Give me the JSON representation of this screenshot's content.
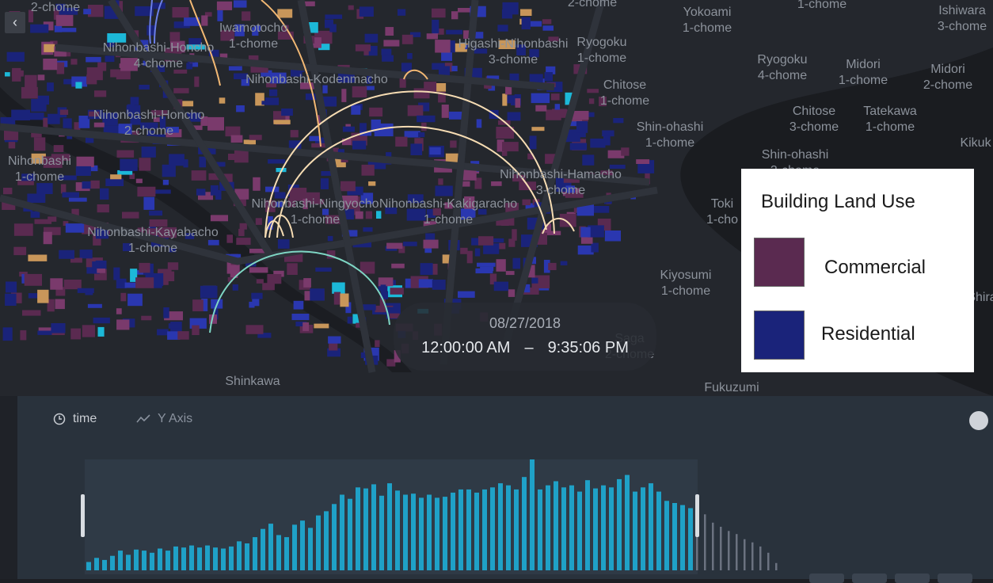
{
  "map": {
    "back_icon": "chevron-left-icon",
    "colors": {
      "commercial": "#5a2a50",
      "commercial_light": "#7a3a6c",
      "residential": "#1a237a",
      "residential_light": "#2a37b0",
      "street": "#2b2e35",
      "water": "#1a1c20",
      "arc_orange": "#f2b874",
      "arc_pale": "#f6dcb3",
      "arc_teal": "#7ed6c4"
    },
    "place_labels": [
      "2-chome",
      "Iwamotocho 1-chome",
      "2-chome",
      "Yokoami 1-chome",
      "1-chome",
      "Ishiwara 3-chome",
      "Nihonbashi-Honcho 4-chome",
      "Higashi-Nihonbashi 3-chome",
      "Ryogoku 1-chome",
      "Ryogoku 4-chome",
      "Midori 1-chome",
      "Midori 2-chome",
      "Nihonbashi-Kodenmacho",
      "Chitose 1-chome",
      "Chitose 3-chome",
      "Tatekawa 1-chome",
      "Nihonbashi-Honcho 2-chome",
      "Shin-ohashi 1-chome",
      "Shin-ohashi 3-chome",
      "Kikuk",
      "Nihonbashi 1-chome",
      "Nihonbashi-Ningyocho 1-chome",
      "Nihonbashi-Kakigaracho 1-chome",
      "Nihonbashi-Hamacho 3-chome",
      "Toki 1-cho",
      "Nihonbashi-Kayabacho 1-chome",
      "Kiyosumi 1-chome",
      "Shinkawa",
      "Fukuzumi",
      "Saga 2-chome",
      "Shira"
    ]
  },
  "time_display": {
    "date": "08/27/2018",
    "start": "12:00:00 AM",
    "separator": "–",
    "end": "9:35:06 PM"
  },
  "legend": {
    "title": "Building Land Use",
    "items": [
      {
        "label": "Commercial",
        "color": "#5a2a50"
      },
      {
        "label": "Residential",
        "color": "#1a237a"
      }
    ]
  },
  "panel": {
    "time_label": "time",
    "time_icon": "clock-icon",
    "y_axis_label": "Y Axis",
    "y_axis_icon": "line-chart-icon",
    "settings_icon": "gear-icon",
    "colors": {
      "bar_selected": "#1fa1c7",
      "bar_unselected": "#6b7280",
      "window": "#2f3a46",
      "handle": "#d9dde2"
    }
  },
  "chart_data": {
    "type": "bar",
    "title": "",
    "xlabel": "time",
    "ylabel": "",
    "selected_range_index": [
      0,
      76
    ],
    "values": [
      8,
      12,
      10,
      14,
      19,
      15,
      20,
      19,
      17,
      21,
      19,
      23,
      22,
      24,
      22,
      24,
      22,
      21,
      23,
      28,
      26,
      32,
      40,
      45,
      34,
      32,
      44,
      48,
      41,
      53,
      57,
      64,
      73,
      69,
      80,
      79,
      83,
      72,
      84,
      77,
      73,
      74,
      70,
      73,
      70,
      71,
      75,
      78,
      78,
      75,
      78,
      80,
      84,
      82,
      78,
      90,
      107,
      78,
      82,
      86,
      80,
      82,
      76,
      87,
      79,
      82,
      80,
      88,
      92,
      76,
      80,
      84,
      76,
      67,
      65,
      63,
      60,
      58,
      54,
      46,
      42,
      38,
      35,
      30,
      27,
      23,
      17,
      7
    ]
  }
}
